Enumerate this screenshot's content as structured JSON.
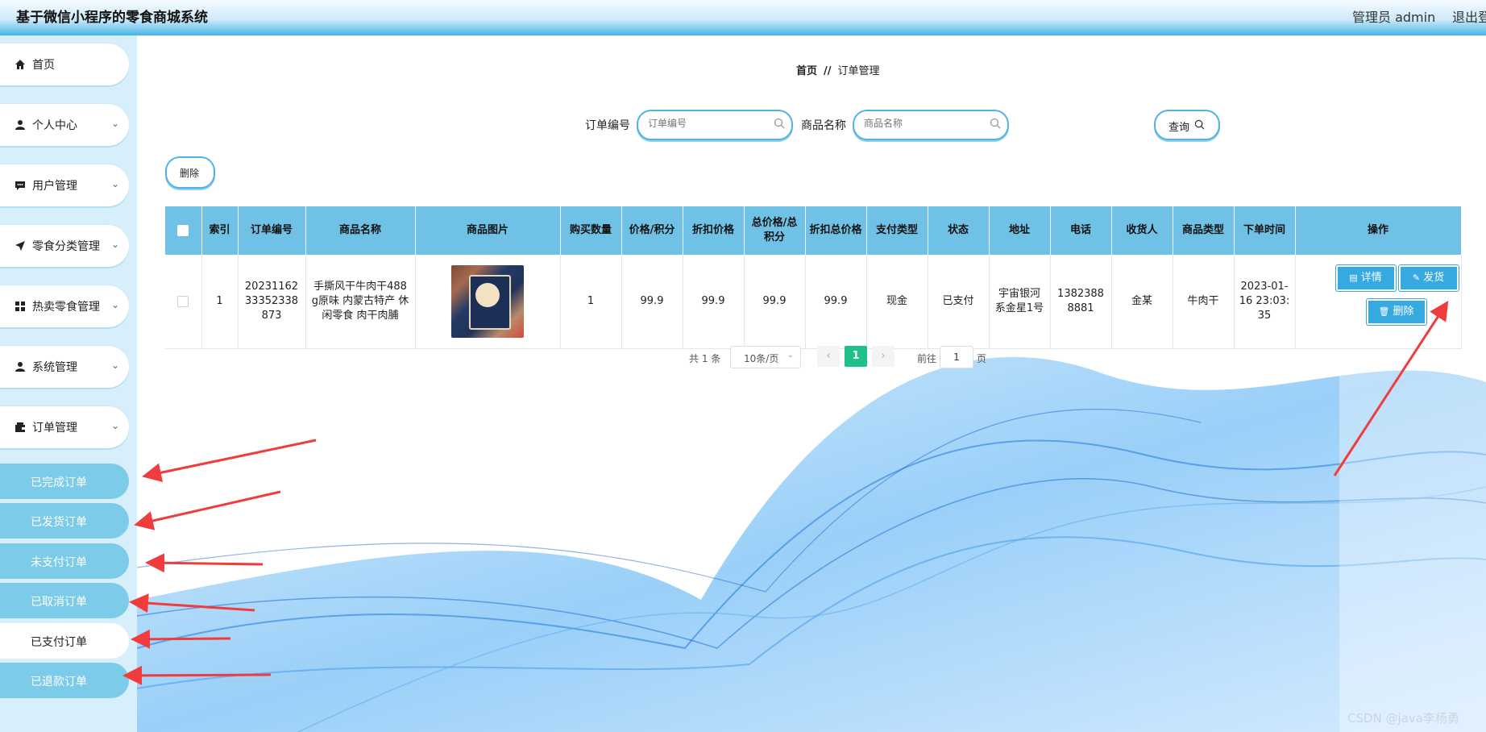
{
  "header": {
    "title": "基于微信小程序的零食商城系统",
    "user": "管理员 admin",
    "logout": "退出登"
  },
  "sidebar": {
    "items": [
      {
        "label": "首页",
        "icon": "home-icon"
      },
      {
        "label": "个人中心",
        "icon": "user-icon"
      },
      {
        "label": "用户管理",
        "icon": "chat-icon"
      },
      {
        "label": "零食分类管理",
        "icon": "send-icon"
      },
      {
        "label": "热卖零食管理",
        "icon": "grid-icon"
      },
      {
        "label": "系统管理",
        "icon": "user-icon"
      },
      {
        "label": "订单管理",
        "icon": "wallet-icon"
      }
    ],
    "sub_items": [
      {
        "label": "已完成订单"
      },
      {
        "label": "已发货订单"
      },
      {
        "label": "未支付订单"
      },
      {
        "label": "已取消订单"
      },
      {
        "label": "已支付订单"
      },
      {
        "label": "已退款订单"
      }
    ]
  },
  "breadcrumb": {
    "home": "首页",
    "separator": "//",
    "current": "订单管理"
  },
  "search": {
    "order_no_label": "订单编号",
    "order_no_placeholder": "订单编号",
    "product_name_label": "商品名称",
    "product_name_placeholder": "商品名称",
    "query_button": "查询"
  },
  "toolbar": {
    "delete_button": "删除"
  },
  "table": {
    "headers": [
      "索引",
      "订单编号",
      "商品名称",
      "商品图片",
      "购买数量",
      "价格/积分",
      "折扣价格",
      "总价格/总积分",
      "折扣总价格",
      "支付类型",
      "状态",
      "地址",
      "电话",
      "收货人",
      "商品类型",
      "下单时间",
      "操作"
    ],
    "rows": [
      {
        "index": "1",
        "order_no": "2023116233352338873",
        "product_name": "手撕风干牛肉干488g原味 内蒙古特产 休闲零食 肉干肉脯",
        "quantity": "1",
        "price": "99.9",
        "discount_price": "99.9",
        "total_price": "99.9",
        "discount_total": "99.9",
        "pay_type": "现金",
        "status": "已支付",
        "address": "宇宙银河系金星1号",
        "phone": "13823888881",
        "receiver": "金某",
        "product_type": "牛肉干",
        "order_time": "2023-01-16 23:03:35"
      }
    ],
    "actions": {
      "detail": "详情",
      "ship": "发货",
      "delete": "删除"
    }
  },
  "pagination": {
    "total": "共 1 条",
    "page_size": "10条/页",
    "current_page": "1",
    "goto_label": "前往",
    "goto_value": "1",
    "page_suffix": "页"
  },
  "watermark": "CSDN @java李杨勇",
  "colors": {
    "header_gradient_end": "#45b4e6",
    "table_header": "#6fc2e6",
    "submenu_bg": "#7ccbe8",
    "action_button": "#36a9e1",
    "page_active": "#20c08a",
    "annotation_arrow": "#f03c3c"
  }
}
